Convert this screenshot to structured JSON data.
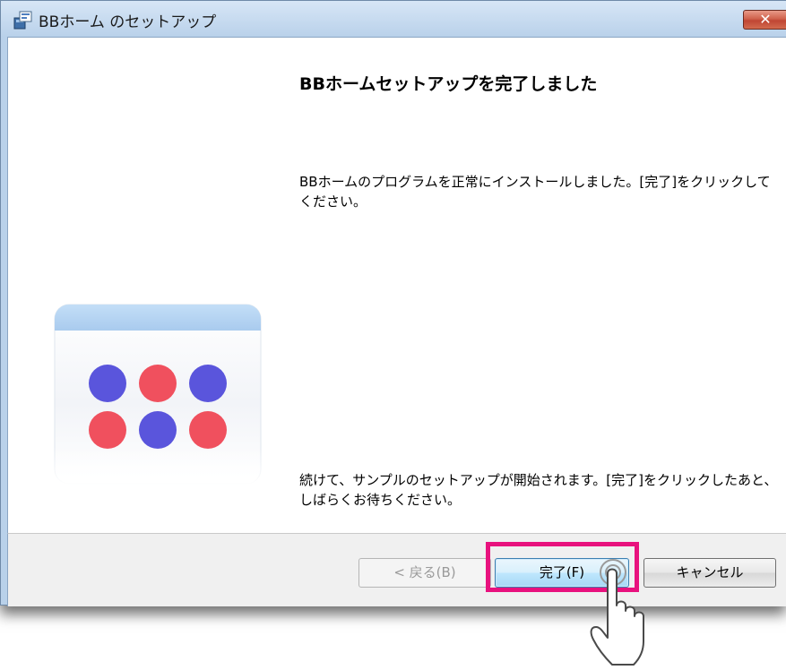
{
  "window": {
    "title": "BBホーム のセットアップ",
    "close_glyph": "✕"
  },
  "content": {
    "heading": "BBホームセットアップを完了しました",
    "message1": "BBホームのプログラムを正常にインストールしました。[完了]をクリックしてください。",
    "message2": "続けて、サンプルのセットアップが開始されます。[完了]をクリックしたあと、しばらくお待ちください。"
  },
  "buttons": {
    "back": "< 戻る(B)",
    "finish": "完了(F)",
    "cancel": "キャンセル"
  },
  "colors": {
    "logo_blue": "#5a55dc",
    "logo_red": "#f0505e",
    "highlight": "#e8127e"
  },
  "icons": [
    "setup-app-icon",
    "close-icon",
    "bb-home-logo",
    "hand-pointer-icon"
  ]
}
